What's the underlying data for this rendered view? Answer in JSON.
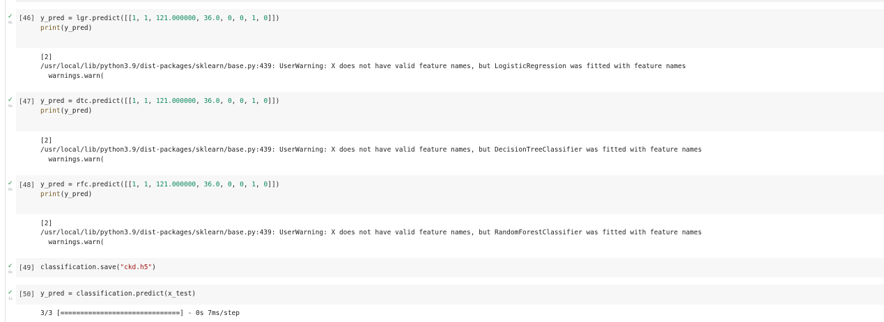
{
  "cells": [
    {
      "exec_count": "[46]",
      "status_icon": "check-icon",
      "duration": "0s",
      "code": {
        "line1": {
          "prefix": "y_pred = lgr.predict([[",
          "n1": "1",
          "sep1": ", ",
          "n2": "1",
          "sep2": ", ",
          "n3": "121.000000",
          "sep3": ", ",
          "n4": "36.0",
          "sep4": ", ",
          "n5": "0",
          "sep5": ", ",
          "n6": "0",
          "sep6": ", ",
          "n7": "1",
          "sep7": ", ",
          "n8": "0",
          "suffix": "]])"
        },
        "line2": {
          "fn": "print",
          "rest": "(y_pred)"
        }
      },
      "output": [
        "[2]",
        "/usr/local/lib/python3.9/dist-packages/sklearn/base.py:439: UserWarning: X does not have valid feature names, but LogisticRegression was fitted with feature names",
        "  warnings.warn("
      ]
    },
    {
      "exec_count": "[47]",
      "status_icon": "check-icon",
      "duration": "0s",
      "code": {
        "line1": {
          "prefix": "y_pred = dtc.predict([[",
          "n1": "1",
          "sep1": ", ",
          "n2": "1",
          "sep2": ", ",
          "n3": "121.000000",
          "sep3": ", ",
          "n4": "36.0",
          "sep4": ", ",
          "n5": "0",
          "sep5": ", ",
          "n6": "0",
          "sep6": ", ",
          "n7": "1",
          "sep7": ", ",
          "n8": "0",
          "suffix": "]])"
        },
        "line2": {
          "fn": "print",
          "rest": "(y_pred)"
        }
      },
      "output": [
        "[2]",
        "/usr/local/lib/python3.9/dist-packages/sklearn/base.py:439: UserWarning: X does not have valid feature names, but DecisionTreeClassifier was fitted with feature names",
        "  warnings.warn("
      ]
    },
    {
      "exec_count": "[48]",
      "status_icon": "check-icon",
      "duration": "0s",
      "code": {
        "line1": {
          "prefix": "y_pred = rfc.predict([[",
          "n1": "1",
          "sep1": ", ",
          "n2": "1",
          "sep2": ", ",
          "n3": "121.000000",
          "sep3": ", ",
          "n4": "36.0",
          "sep4": ", ",
          "n5": "0",
          "sep5": ", ",
          "n6": "0",
          "sep6": ", ",
          "n7": "1",
          "sep7": ", ",
          "n8": "0",
          "suffix": "]])"
        },
        "line2": {
          "fn": "print",
          "rest": "(y_pred)"
        }
      },
      "output": [
        "[2]",
        "/usr/local/lib/python3.9/dist-packages/sklearn/base.py:439: UserWarning: X does not have valid feature names, but RandomForestClassifier was fitted with feature names",
        "  warnings.warn("
      ]
    },
    {
      "exec_count": "[49]",
      "status_icon": "check-icon",
      "duration": "0s",
      "code": {
        "prefix": "classification.save(",
        "str": "\"ckd.h5\"",
        "suffix": ")"
      }
    },
    {
      "exec_count": "[50]",
      "status_icon": "check-icon",
      "duration": "1s",
      "code": {
        "text": "y_pred = classification.predict(x_test)"
      },
      "output": [
        "3/3 [==============================] - 0s 7ms/step"
      ]
    }
  ]
}
